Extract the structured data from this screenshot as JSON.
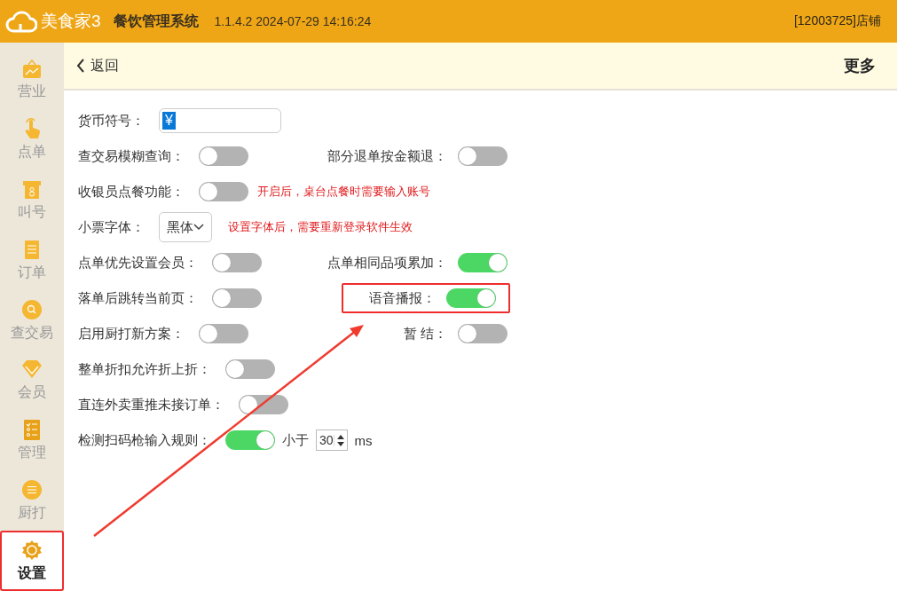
{
  "header": {
    "logo": "美食家3",
    "title": "餐饮管理系统",
    "version": "1.1.4.2 2024-07-29 14:16:24",
    "shop": "[12003725]店铺"
  },
  "sidebar": {
    "items": [
      {
        "label": "营业",
        "kind": "chart",
        "selected": false,
        "highlighted": false
      },
      {
        "label": "点单",
        "kind": "hand",
        "selected": false,
        "highlighted": false
      },
      {
        "label": "叫号",
        "kind": "ticket",
        "selected": false,
        "highlighted": false
      },
      {
        "label": "订单",
        "kind": "list",
        "selected": false,
        "highlighted": false
      },
      {
        "label": "查交易",
        "kind": "search",
        "selected": false,
        "highlighted": false
      },
      {
        "label": "会员",
        "kind": "diamond",
        "selected": false,
        "highlighted": false
      },
      {
        "label": "管理",
        "kind": "checklist",
        "selected": false,
        "highlighted": false
      },
      {
        "label": "厨打",
        "kind": "lines",
        "selected": false,
        "highlighted": false
      },
      {
        "label": "设置",
        "kind": "gear",
        "selected": true,
        "highlighted": true
      }
    ]
  },
  "subheader": {
    "back": "返回",
    "more": "更多"
  },
  "rows": [
    {
      "left": {
        "kind": "input",
        "label": "货币符号：",
        "value": "¥",
        "text_selected": true
      }
    },
    {
      "left": {
        "kind": "toggle",
        "label": "查交易模糊查询：",
        "on": false
      },
      "right": {
        "kind": "toggle",
        "label": "部分退单按金额退：",
        "on": false,
        "highlighted": false
      }
    },
    {
      "left": {
        "kind": "toggle",
        "label": "收银员点餐功能：",
        "on": false,
        "note": "开启后，桌台点餐时需要输入账号"
      }
    },
    {
      "left": {
        "kind": "select",
        "label": "小票字体：",
        "value": "黑体",
        "note": "设置字体后，需要重新登录软件生效"
      }
    },
    {
      "left": {
        "kind": "toggle",
        "label": "点单优先设置会员：",
        "on": false
      },
      "right": {
        "kind": "toggle",
        "label": "点单相同品项累加：",
        "on": true,
        "highlighted": false
      }
    },
    {
      "left": {
        "kind": "toggle",
        "label": "落单后跳转当前页：",
        "on": false
      },
      "right": {
        "kind": "toggle",
        "label": "语音播报：",
        "on": true,
        "highlighted": true
      }
    },
    {
      "left": {
        "kind": "toggle",
        "label": "启用厨打新方案：",
        "on": false
      },
      "right": {
        "kind": "toggle",
        "label": "暂 结：",
        "on": false,
        "highlighted": false
      }
    },
    {
      "left": {
        "kind": "toggle",
        "label": "整单折扣允许折上折：",
        "on": false
      }
    },
    {
      "left": {
        "kind": "toggle",
        "label": "直连外卖重推未接订单：",
        "on": false
      }
    },
    {
      "left": {
        "kind": "threshold",
        "label": "检测扫码枪输入规则：",
        "on": true,
        "prefix": "小于",
        "value": "30",
        "unit": "ms"
      }
    }
  ]
}
